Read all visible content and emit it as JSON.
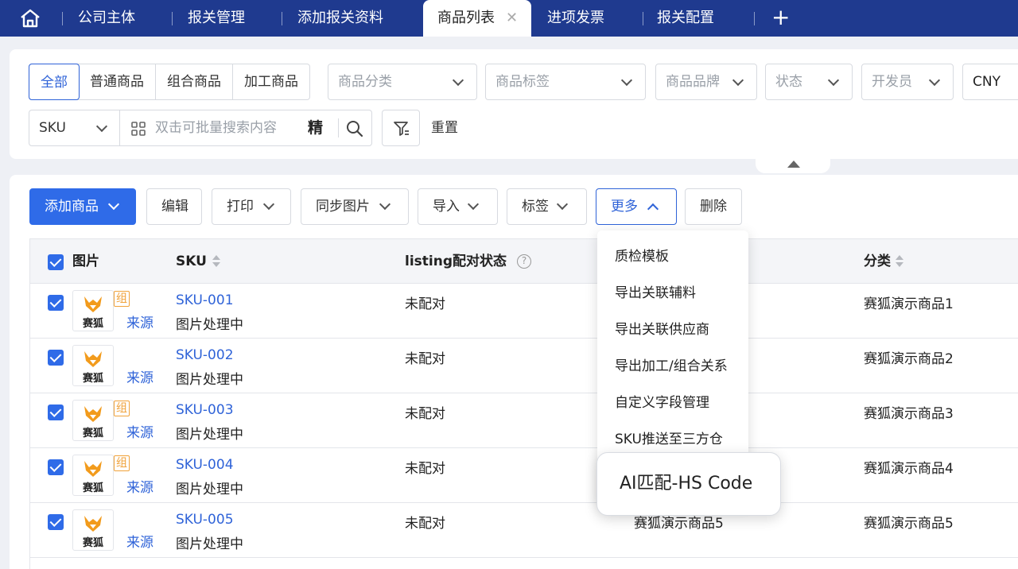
{
  "nav": {
    "tabs": [
      "公司主体",
      "报关管理",
      "添加报关资料",
      "商品列表",
      "进项发票",
      "报关配置"
    ],
    "active_tab": "商品列表",
    "close_glyph": "✕",
    "plus_glyph": "+"
  },
  "filter": {
    "type_segments": [
      "全部",
      "普通商品",
      "组合商品",
      "加工商品"
    ],
    "selected_segment": "全部",
    "category_placeholder": "商品分类",
    "tag_placeholder": "商品标签",
    "brand_placeholder": "商品品牌",
    "status_placeholder": "状态",
    "developer_placeholder": "开发员",
    "currency": "CNY",
    "search_field": "SKU",
    "search_placeholder": "双击可批量搜索内容",
    "exact_label": "精",
    "reset_label": "重置"
  },
  "toolbar": {
    "add": "添加商品",
    "edit": "编辑",
    "print": "打印",
    "sync_images": "同步图片",
    "import": "导入",
    "tags": "标签",
    "more": "更多",
    "delete": "删除"
  },
  "table": {
    "columns": {
      "image": "图片",
      "sku": "SKU",
      "listing_status": "listing配对状态",
      "help": "?",
      "category": "分类"
    },
    "rows": [
      {
        "sku": "SKU-001",
        "status": "图片处理中",
        "match": "未配对",
        "category": "赛狐演示商品1",
        "combo": true
      },
      {
        "sku": "SKU-002",
        "status": "图片处理中",
        "match": "未配对",
        "category": "赛狐演示商品2",
        "combo": false
      },
      {
        "sku": "SKU-003",
        "status": "图片处理中",
        "match": "未配对",
        "category": "赛狐演示商品3",
        "combo": true
      },
      {
        "sku": "SKU-004",
        "status": "图片处理中",
        "match": "未配对",
        "category": "赛狐演示商品4",
        "combo": true
      },
      {
        "sku": "SKU-005",
        "status": "图片处理中",
        "match": "未配对",
        "category": "赛狐演示商品5",
        "combo": false,
        "extra_col": "赛狐演示商品5"
      }
    ],
    "thumb_text": "赛狐",
    "combo_badge": "组",
    "source_link": "来源"
  },
  "more_menu": {
    "items": [
      "质检模板",
      "导出关联辅料",
      "导出关联供应商",
      "导出加工/组合关系",
      "自定义字段管理",
      "SKU推送至三方仓"
    ],
    "highlighted": "AI匹配-HS Code"
  },
  "colors": {
    "nav_bg": "#1f3a8f",
    "primary": "#2f6be8",
    "link": "#2f63d8",
    "combo_badge": "#f0a23a"
  }
}
